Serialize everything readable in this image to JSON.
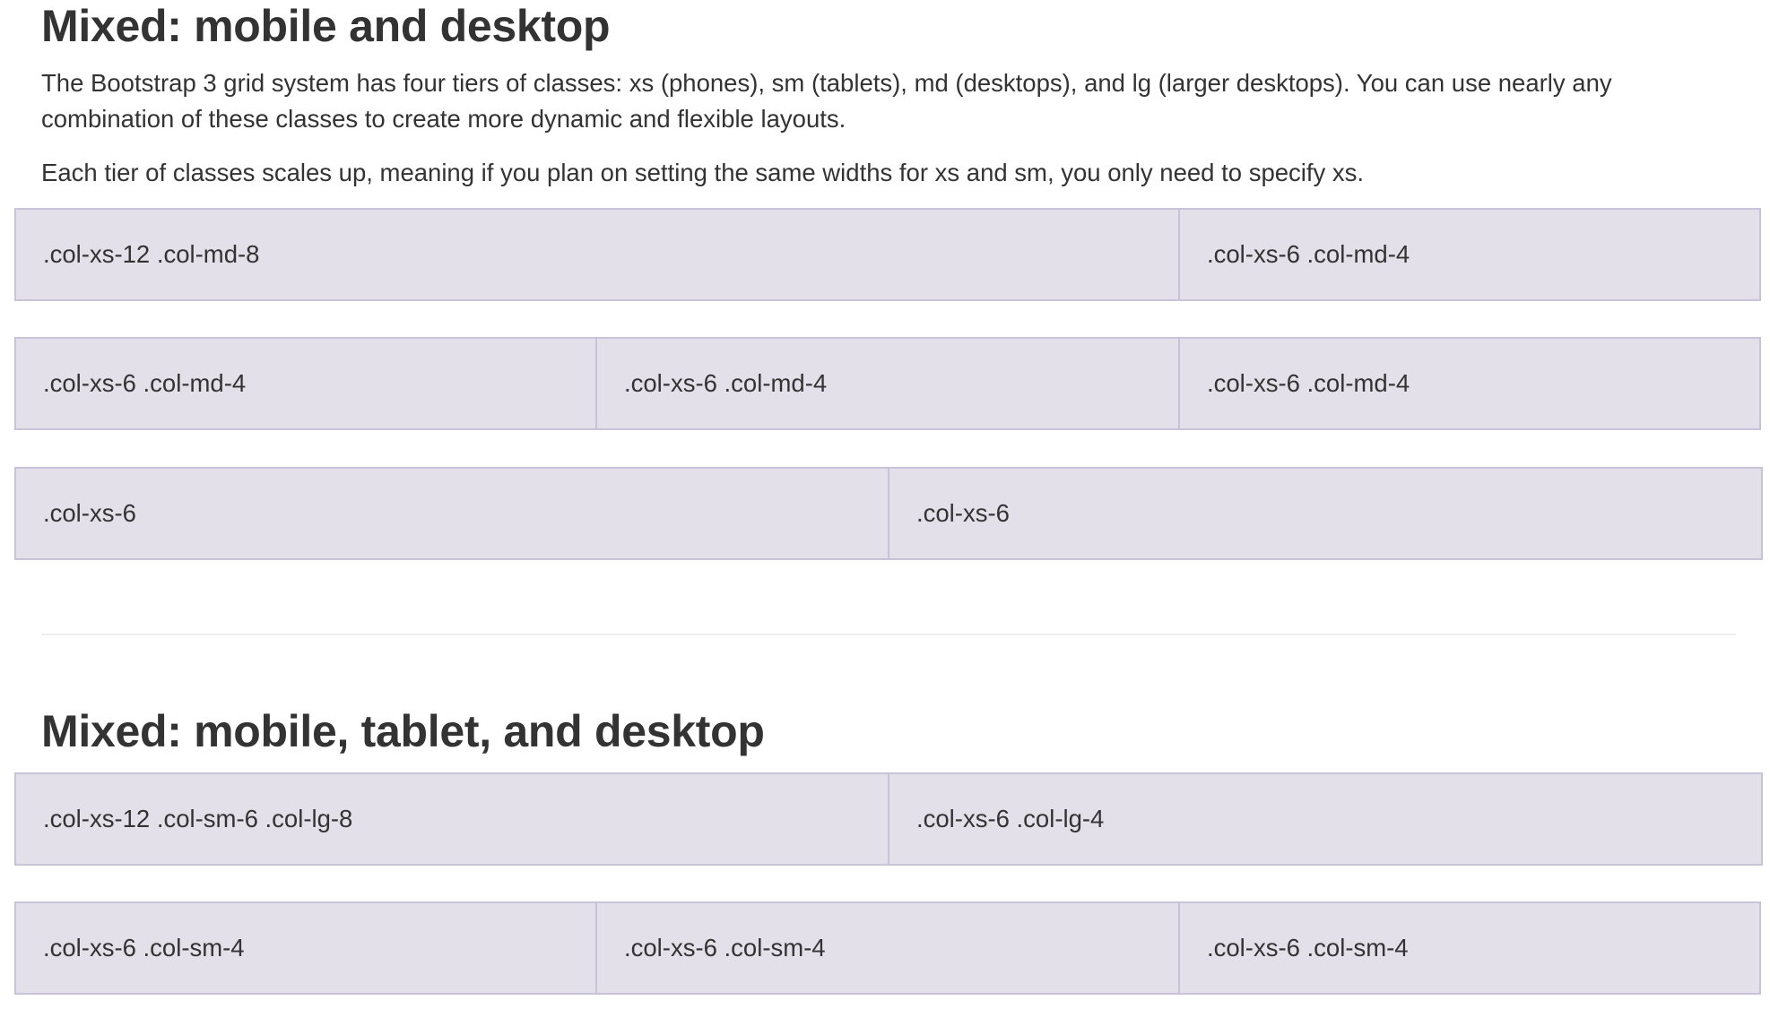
{
  "section1": {
    "title": "Mixed: mobile and desktop",
    "paragraph1": "The Bootstrap 3 grid system has four tiers of classes: xs (phones), sm (tablets), md (desktops), and lg (larger desktops). You can use nearly any",
    "paragraph1_line2": "combination of these classes to create more dynamic and flexible layouts.",
    "paragraph2": "Each tier of classes scales up, meaning if you plan on setting the same widths for xs and sm, you only need to specify xs.",
    "rows": [
      {
        "cells": [
          ".col-xs-12 .col-md-8",
          ".col-xs-6 .col-md-4"
        ]
      },
      {
        "cells": [
          ".col-xs-6 .col-md-4",
          ".col-xs-6 .col-md-4",
          ".col-xs-6 .col-md-4"
        ]
      },
      {
        "cells": [
          ".col-xs-6",
          ".col-xs-6"
        ]
      }
    ]
  },
  "section2": {
    "title": "Mixed: mobile, tablet, and desktop",
    "rows": [
      {
        "cells": [
          ".col-xs-12 .col-sm-6 .col-lg-8",
          ".col-xs-6 .col-lg-4"
        ]
      },
      {
        "cells": [
          ".col-xs-6 .col-sm-4",
          ".col-xs-6 .col-sm-4",
          ".col-xs-6 .col-sm-4"
        ]
      }
    ]
  },
  "colors": {
    "cell_background": "#e3e0ea",
    "cell_border": "#c9c3d9",
    "text": "#333333"
  }
}
